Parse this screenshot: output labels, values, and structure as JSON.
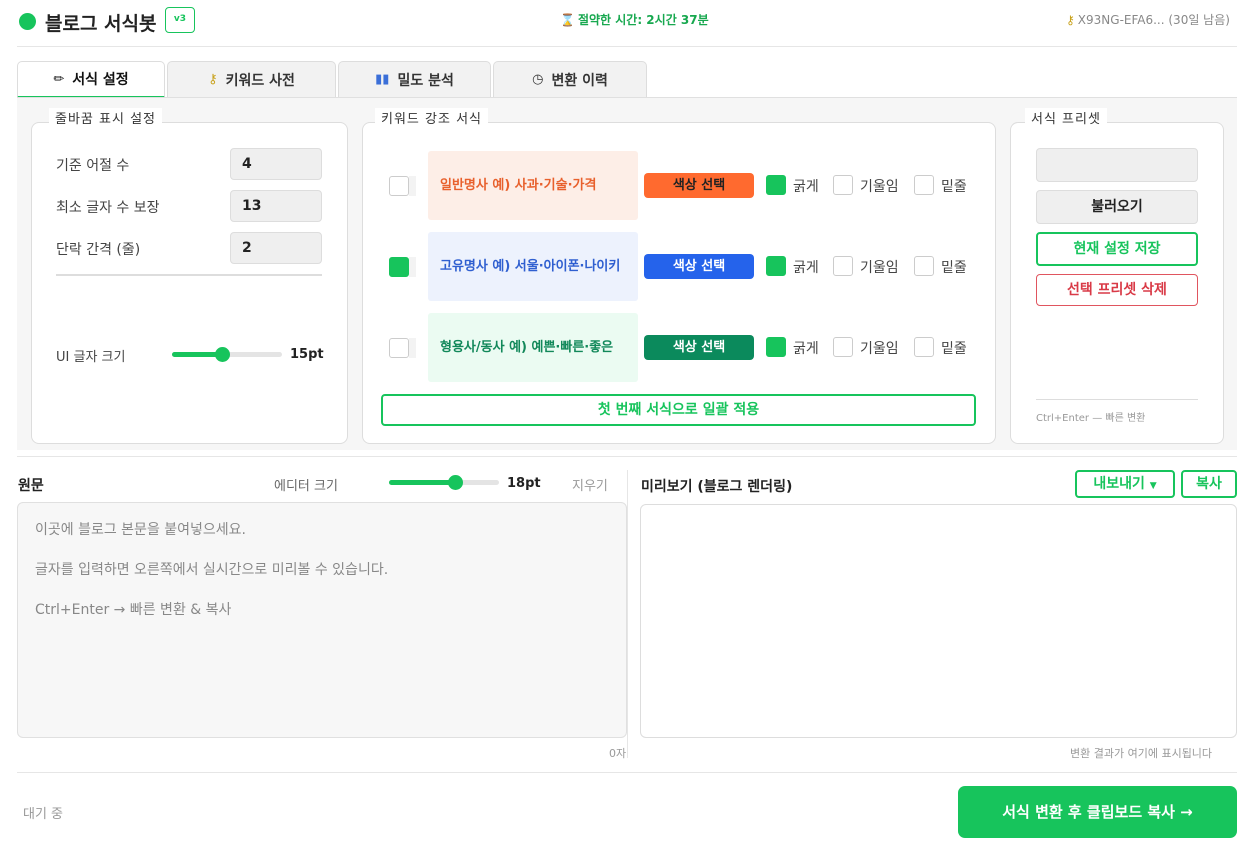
{
  "header": {
    "title": "블로그 서식봇",
    "version": "v3",
    "saved_time": "절약한 시간: 2시간 37분",
    "license": "X93NG-EFA6... (30일 남음)"
  },
  "tabs": [
    {
      "label": "서식 설정",
      "icon": "pencil-icon"
    },
    {
      "label": "키워드 사전",
      "icon": "key-icon"
    },
    {
      "label": "밀도 분석",
      "icon": "bar-chart-icon"
    },
    {
      "label": "변환 이력",
      "icon": "clock-icon"
    }
  ],
  "line_break": {
    "legend": "줄바꿈 표시 설정",
    "phrase_count_label": "기준 어절 수",
    "phrase_count_value": "4",
    "min_chars_label": "최소 글자 수 보장",
    "min_chars_value": "13",
    "para_gap_label": "단락 간격 (줄)",
    "para_gap_value": "2",
    "ui_font_label": "UI 글자 크기",
    "ui_font_value": "15pt",
    "ui_font_level": 0.45
  },
  "keyword_format": {
    "legend": "키워드 강조 서식",
    "rows": [
      {
        "label": "일반명사   예) 사과·기술·가격",
        "color_btn": "색상 선택",
        "text_color": "#e8602c",
        "bg": "#fdeee7",
        "btn_color": "#ff6a2f",
        "btn_text": "#222222",
        "checked": false,
        "bold": true,
        "italic": false,
        "underline": false
      },
      {
        "label": "고유명사   예) 서울·아이폰·나이키",
        "color_btn": "색상 선택",
        "text_color": "#2f5fd0",
        "bg": "#edf2fd",
        "btn_color": "#2563eb",
        "btn_text": "#ffffff",
        "checked": true,
        "bold": true,
        "italic": false,
        "underline": false
      },
      {
        "label": "형용사/동사   예) 예쁜·빠른·좋은",
        "color_btn": "색상 선택",
        "text_color": "#12885a",
        "bg": "#ebfbf2",
        "btn_color": "#0b8a5c",
        "btn_text": "#ffffff",
        "checked": false,
        "bold": true,
        "italic": false,
        "underline": false
      }
    ],
    "bold_label": "굵게",
    "italic_label": "기울임",
    "underline_label": "밑줄",
    "apply_all": "첫 번째 서식으로 일괄 적용"
  },
  "presets": {
    "legend": "서식 프리셋",
    "select_value": "",
    "load": "불러오기",
    "save": "현재 설정 저장",
    "delete": "선택 프리셋 삭제",
    "hint": "Ctrl+Enter — 빠른 변환"
  },
  "source": {
    "title": "원문",
    "editor_size_label": "에디터 크기",
    "editor_size_value": "18pt",
    "editor_size_level": 0.6,
    "clear": "지우기",
    "placeholder": "이곳에 블로그 본문을 붙여넣으세요.\n\n글자를 입력하면 오른쪽에서 실시간으로 미리볼 수 있습니다.\n\nCtrl+Enter  →  빠른 변환 & 복사",
    "char_count": "0자"
  },
  "preview": {
    "title": "미리보기 (블로그 렌더링)",
    "export": "내보내기",
    "copy": "복사",
    "hint": "변환 결과가 여기에 표시됩니다"
  },
  "footer": {
    "status": "대기 중",
    "convert": "서식 변환 후 클립보드 복사 →"
  },
  "colors": {
    "accent": "#17c45c",
    "danger": "#d93a47"
  }
}
